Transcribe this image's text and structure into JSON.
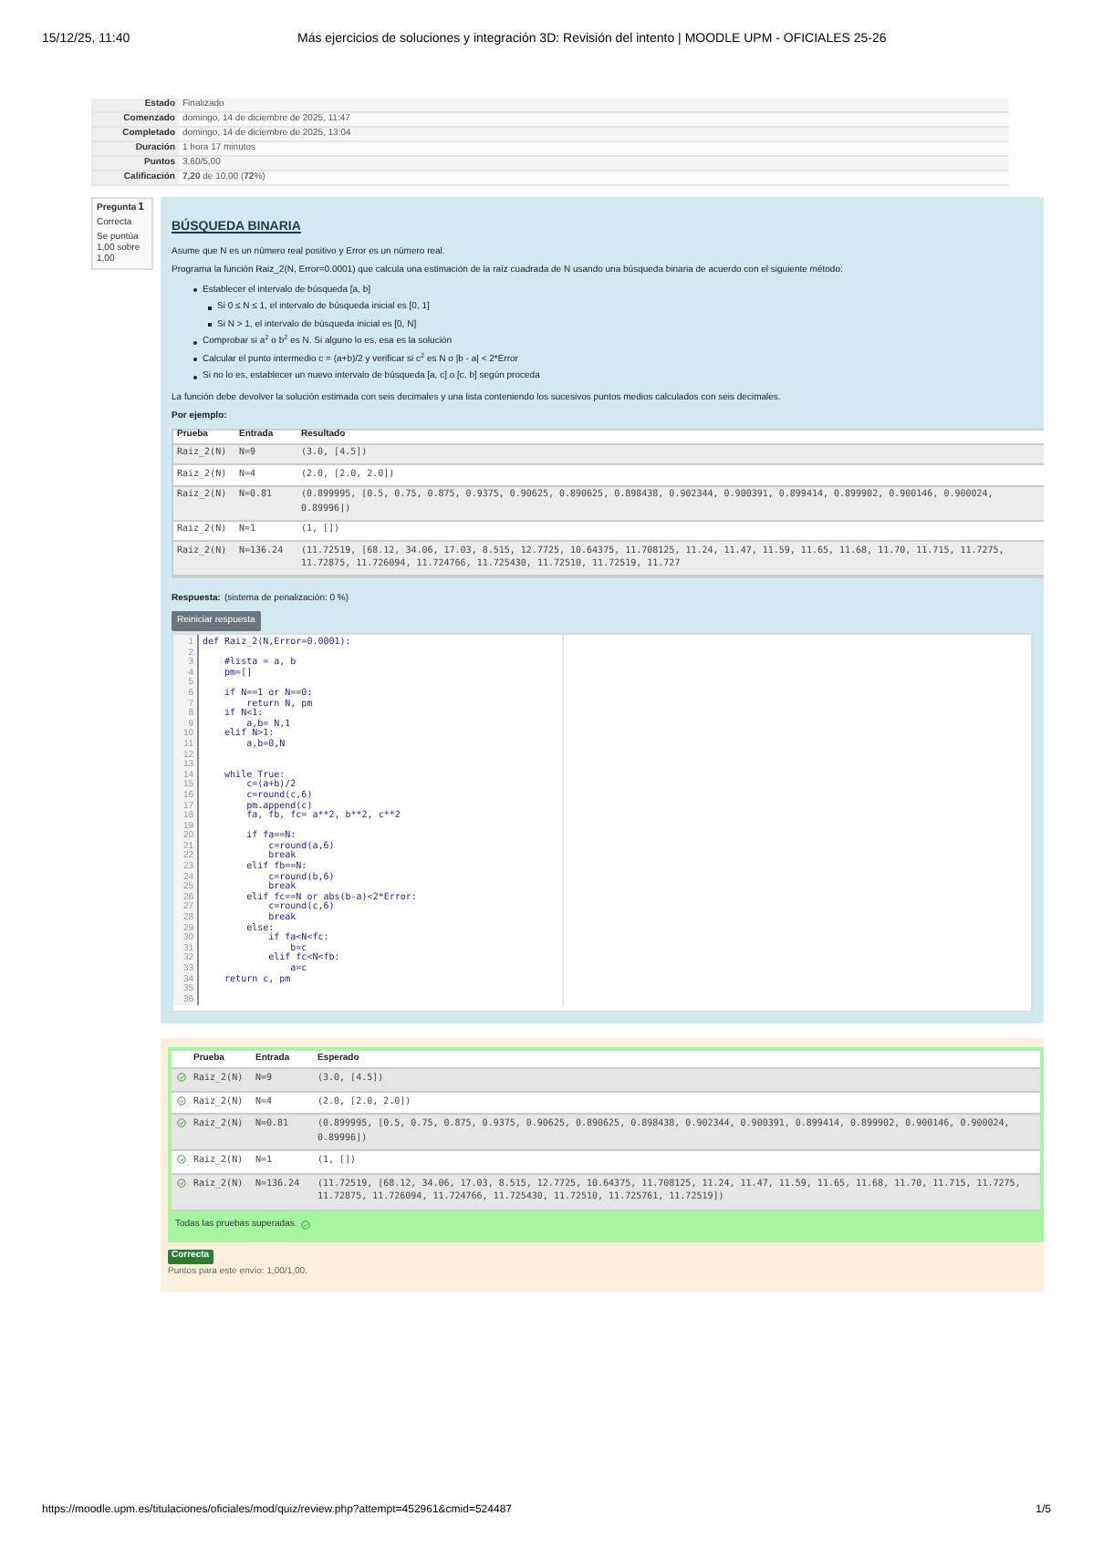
{
  "print_header": {
    "date": "15/12/25, 11:40",
    "title": "Más ejercicios de soluciones y integración 3D: Revisión del intento | MOODLE UPM - OFICIALES 25-26"
  },
  "summary": [
    {
      "label": "Estado",
      "value": "Finalizado"
    },
    {
      "label": "Comenzado",
      "value": "domingo, 14 de diciembre de 2025, 11:47"
    },
    {
      "label": "Completado",
      "value": "domingo, 14 de diciembre de 2025, 13:04"
    },
    {
      "label": "Duración",
      "value": "1 hora 17 minutos"
    },
    {
      "label": "Puntos",
      "value": "3,60/5,00"
    },
    {
      "label": "Calificación",
      "value": "**7,20** de 10,00 (**72**%)"
    }
  ],
  "question_info": {
    "number_label": "Pregunta",
    "number": "1",
    "state": "Correcta",
    "grade": "Se puntúa 1,00 sobre 1,00"
  },
  "question": {
    "title": "BÚSQUEDA BINARIA",
    "paragraphs": [
      "Asume que N es un número real positivo y Error es un número real.",
      "Programa la función Raiz_2(N, Error=0.0001) que calcula una estimación de la raíz cuadrada de N usando una búsqueda binaria de acuerdo con el siguiente método:"
    ],
    "steps": [
      {
        "text": "Establecer el intervalo de búsqueda [a, b]",
        "children": [
          {
            "text": "Si 0 ≤ N ≤ 1, el intervalo de búsqueda inicial es [0, 1]"
          },
          {
            "text": "Si N > 1, el intervalo de búsqueda inicial es [0, N]"
          }
        ]
      },
      {
        "text": "Comprobar si a$^{2}$ o b$^{2}$ es N. Si alguno lo es, esa es la solución"
      },
      {
        "text": "Calcular el punto intermedio c = (a+b)/2 y verificar si c$^{2}$ es N o |b - a| < 2*Error"
      },
      {
        "text": "Si no lo es, establecer un nuevo intervalo de búsqueda [a, c] o [c, b] según proceda"
      }
    ],
    "closing": "La función debe devolver la solución estimada con seis decimales y una lista conteniendo los sucesivos puntos medios calculados con seis decimales.",
    "example_label": "Por ejemplo:",
    "example_table": {
      "columns": [
        "Prueba",
        "Entrada",
        "Resultado"
      ],
      "rows": [
        {
          "test": "Raiz_2(N)",
          "input": "N=9",
          "result": "(3.0, [4.5])"
        },
        {
          "test": "Raiz_2(N)",
          "input": "N=4",
          "result": "(2.0, [2.0, 2.0])"
        },
        {
          "test": "Raiz_2(N)",
          "input": "N=0.81",
          "result": "(0.899995, [0.5, 0.75, 0.875, 0.9375, 0.90625, 0.890625, 0.898438, 0.902344, 0.900391, 0.899414, 0.899902, 0.900146, 0.900024, 0.89996])"
        },
        {
          "test": "Raiz_2(N)",
          "input": "N=1",
          "result": "(1, [])"
        },
        {
          "test": "Raiz_2(N)",
          "input": "N=136.24",
          "result": "(11.72519, [68.12, 34.06, 17.03, 8.515, 12.7725, 10.64375, 11.708125, 11.24, 11.47, 11.59, 11.65, 11.68, 11.70, 11.715, 11.7275, 11.72875, 11.726094, 11.724766, 11.725430, 11.72510, 11.72519, 11.727"
        }
      ]
    }
  },
  "answer": {
    "label": "Respuesta:",
    "penalty": "(sistema de penalización: 0 %)",
    "reset_button": "Reiniciar respuesta",
    "code": [
      {
        "number": "1",
        "text": "def Raiz_2(N,Error=0.0001):"
      },
      {
        "number": "2"
      },
      {
        "number": "3",
        "text": "    #lista = a, b"
      },
      {
        "number": "4",
        "text": "    pm=[]"
      },
      {
        "number": "5"
      },
      {
        "number": "6",
        "text": "    if N==1 or N==0:"
      },
      {
        "number": "7",
        "text": "        return N, pm"
      },
      {
        "number": "8",
        "text": "    if N<1:"
      },
      {
        "number": "9",
        "text": "        a,b= N,1"
      },
      {
        "number": "10",
        "text": "    elif N>1:"
      },
      {
        "number": "11",
        "text": "        a,b=0,N"
      },
      {
        "number": "12"
      },
      {
        "number": "13"
      },
      {
        "number": "14",
        "text": "    while True:"
      },
      {
        "number": "15",
        "text": "        c=(a+b)/2"
      },
      {
        "number": "16",
        "text": "        c=round(c,6)"
      },
      {
        "number": "17",
        "text": "        pm.append(c)"
      },
      {
        "number": "18",
        "text": "        fa, fb, fc= a**2, b**2, c**2"
      },
      {
        "number": "19"
      },
      {
        "number": "20",
        "text": "        if fa==N:"
      },
      {
        "number": "21",
        "text": "            c=round(a,6)"
      },
      {
        "number": "22",
        "text": "            break"
      },
      {
        "number": "23",
        "text": "        elif fb==N:"
      },
      {
        "number": "24",
        "text": "            c=round(b,6)"
      },
      {
        "number": "25",
        "text": "            break"
      },
      {
        "number": "26",
        "text": "        elif fc==N or abs(b-a)<2*Error:"
      },
      {
        "number": "27",
        "text": "            c=round(c,6)"
      },
      {
        "number": "28",
        "text": "            break"
      },
      {
        "number": "29",
        "text": "        else:"
      },
      {
        "number": "30",
        "text": "            if fa<N<fc:"
      },
      {
        "number": "31",
        "text": "                b=c"
      },
      {
        "number": "32",
        "text": "            elif fc<N<fb:"
      },
      {
        "number": "33",
        "text": "                a=c"
      },
      {
        "number": "34",
        "text": "    return c, pm"
      },
      {
        "number": "35"
      },
      {
        "number": "36"
      }
    ]
  },
  "feedback": {
    "columns": [
      "Prueba",
      "Entrada",
      "Esperado"
    ],
    "rows": [
      {
        "passed": true,
        "test": "Raiz_2(N)",
        "input": "N=9",
        "expected": "(3.0, [4.5])"
      },
      {
        "passed": true,
        "test": "Raiz_2(N)",
        "input": "N=4",
        "expected": "(2.0, [2.0, 2.0])"
      },
      {
        "passed": true,
        "test": "Raiz_2(N)",
        "input": "N=0.81",
        "expected": "(0.899995, [0.5, 0.75, 0.875, 0.9375, 0.90625, 0.890625, 0.898438, 0.902344, 0.900391, 0.899414, 0.899902, 0.900146, 0.900024, 0.89996])"
      },
      {
        "passed": true,
        "test": "Raiz_2(N)",
        "input": "N=1",
        "expected": "(1, [])"
      },
      {
        "passed": true,
        "test": "Raiz_2(N)",
        "input": "N=136.24",
        "expected": "(11.72519, [68.12, 34.06, 17.03, 8.515, 12.7725, 10.64375, 11.708125, 11.24, 11.47, 11.59, 11.65, 11.68, 11.70, 11.715, 11.7275, 11.72875, 11.726094, 11.724766, 11.725430, 11.72510, 11.725761, 11.72519])"
      }
    ],
    "summary": "Todas las pruebas superadas.",
    "all_passed": true,
    "badge": "Correcta",
    "points": "Puntos para este envío: 1,00/1,00."
  },
  "print_footer": {
    "url": "https://moodle.upm.es/titulaciones/oficiales/mod/quiz/review.php?attempt=452961&cmid=524487",
    "page": "1/5"
  }
}
